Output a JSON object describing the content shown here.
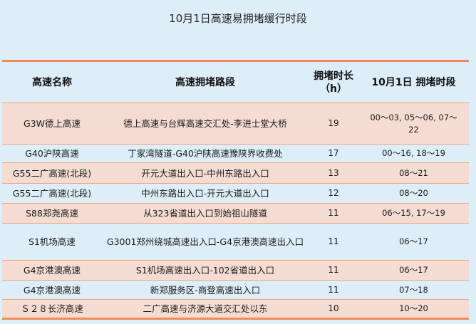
{
  "title": "10月1日高速易拥堵缓行时段",
  "headers": {
    "name": "高速名称",
    "route": "高速拥堵路段",
    "hours_line1": "拥堵时长",
    "hours_line2": "（h）",
    "time": "10月1日 拥堵时段"
  },
  "rows": [
    {
      "name": "G3W德上高速",
      "route": "德上高速与台辉高速交汇处-李进士堂大桥",
      "hours": "19",
      "time_line1": "00～03, 05～06, 07～",
      "time_line2": "22"
    },
    {
      "name": "G40沪陕高速",
      "route": "丁家湾隧道-G40沪陕高速豫陕界收费处",
      "hours": "17",
      "time_line1": "00～16, 18～19",
      "time_line2": ""
    },
    {
      "name": "G55二广高速(北段)",
      "route": "开元大道出入口-中州东路出入口",
      "hours": "13",
      "time_line1": "08～21",
      "time_line2": ""
    },
    {
      "name": "G55二广高速(北段)",
      "route": "中州东路出入口-开元大道出入口",
      "hours": "12",
      "time_line1": "08～20",
      "time_line2": ""
    },
    {
      "name": "S88郑尧高速",
      "route": "从323省道出入口到始祖山隧道",
      "hours": "11",
      "time_line1": "06～15, 17～19",
      "time_line2": ""
    },
    {
      "name": "S1机场高速",
      "route": "G3001郑州绕城高速出入口-G4京港澳高速出入口",
      "hours": "11",
      "time_line1": "06～17",
      "time_line2": ""
    },
    {
      "name": "G4京港澳高速",
      "route": "S1机场高速出入口-102省道出入口",
      "hours": "11",
      "time_line1": "06～17",
      "time_line2": ""
    },
    {
      "name": "G4京港澳高速",
      "route": "新郑服务区-商登高速出入口",
      "hours": "11",
      "time_line1": "07～18",
      "time_line2": ""
    },
    {
      "name": "Ｓ２８长济高速",
      "route": "二广高速与济源大道交汇处以东",
      "hours": "10",
      "time_line1": "10～20",
      "time_line2": ""
    }
  ]
}
